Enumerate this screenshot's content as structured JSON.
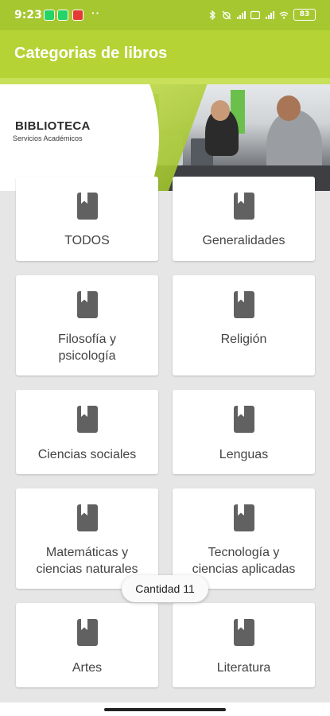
{
  "status_bar": {
    "time": "9:23",
    "dots": "··",
    "battery": "83"
  },
  "app_bar": {
    "title": "Categorias de libros"
  },
  "banner": {
    "logo_title": "BIBLIOTECA",
    "logo_subtitle": "Servicios Académicos"
  },
  "categories": [
    {
      "label": "TODOS",
      "icon": "book-icon"
    },
    {
      "label": "Generalidades",
      "icon": "book-icon"
    },
    {
      "label": "Filosofía y psicología",
      "icon": "book-icon"
    },
    {
      "label": "Religión",
      "icon": "book-icon"
    },
    {
      "label": "Ciencias sociales",
      "icon": "book-icon"
    },
    {
      "label": "Lenguas",
      "icon": "book-icon"
    },
    {
      "label": "Matemáticas y ciencias naturales",
      "icon": "book-icon"
    },
    {
      "label": "Tecnología y ciencias aplicadas",
      "icon": "book-icon"
    },
    {
      "label": "Artes",
      "icon": "book-icon"
    },
    {
      "label": "Literatura",
      "icon": "book-icon"
    }
  ],
  "toast": {
    "text": "Cantidad 11"
  },
  "colors": {
    "status_bar": "#a6c730",
    "app_bar": "#b5d335",
    "icon": "#616161"
  }
}
